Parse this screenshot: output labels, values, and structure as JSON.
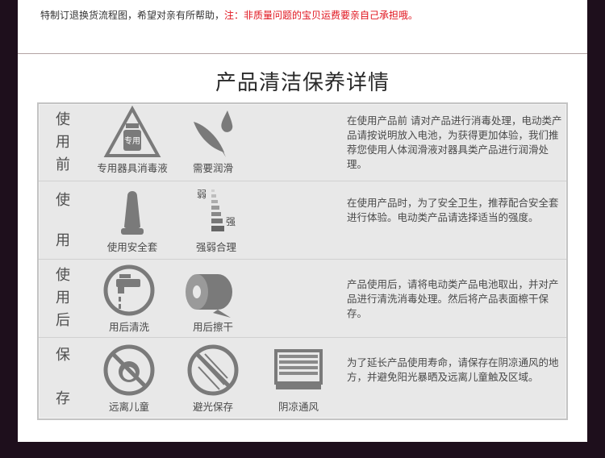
{
  "notice": {
    "text": "特制订退换货流程图，希望对亲有所帮助，",
    "note": "注：非质量问题的宝贝运费要亲自己承担哦。"
  },
  "title": "产品清洁保养详情",
  "rows": [
    {
      "label_chars": [
        "使",
        "用",
        "前"
      ],
      "items": [
        {
          "icon": "disinfectant-bottle-icon",
          "icon_text": "专用",
          "caption": "专用器具消毒液"
        },
        {
          "icon": "lubricant-drop-icon",
          "caption": "需要润滑"
        }
      ],
      "description": "在使用产品前 请对产品进行消毒处理，电动类产品请按说明放入电池，为获得更加体验，我们推荐您使用人体润滑液对器具类产品进行润滑处理。"
    },
    {
      "label_chars": [
        "使",
        "用"
      ],
      "items": [
        {
          "icon": "condom-icon",
          "caption": "使用安全套"
        },
        {
          "icon": "intensity-meter-icon",
          "caption": "强弱合理",
          "weak_text": "弱",
          "strong_text": "强"
        }
      ],
      "description": "在使用产品时，为了安全卫生，推荐配合安全套进行体验。电动类产品请选择适当的强度。"
    },
    {
      "label_chars": [
        "使",
        "用",
        "后"
      ],
      "items": [
        {
          "icon": "faucet-icon",
          "caption": "用后清洗"
        },
        {
          "icon": "tissue-roll-icon",
          "caption": "用后擦干"
        }
      ],
      "description": "产品使用后，请将电动类产品电池取出，并对产品进行清洗消毒处理。然后将产品表面檫干保存。"
    },
    {
      "label_chars": [
        "保",
        "存"
      ],
      "items": [
        {
          "icon": "no-children-icon",
          "caption": "远离儿童"
        },
        {
          "icon": "no-sunlight-icon",
          "caption": "避光保存"
        },
        {
          "icon": "ventilation-icon",
          "caption": "阴凉通风"
        }
      ],
      "description": "为了延长产品使用寿命，请保存在阴凉通风的地方，并避免阳光暴晒及远离儿童触及区域。"
    }
  ],
  "colors": {
    "background": "#1e0f1c",
    "panel": "#e8e8e8",
    "icon": "#7a7a7a",
    "notice_red": "#e0141e"
  }
}
